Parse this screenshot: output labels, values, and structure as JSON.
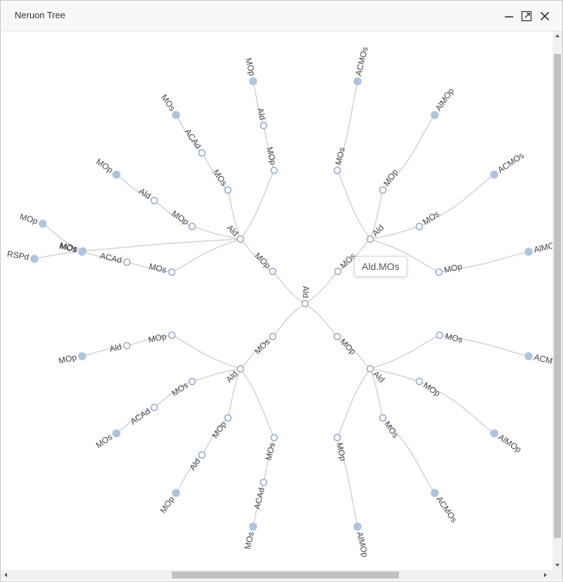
{
  "window": {
    "title": "Neruon Tree"
  },
  "tooltip": {
    "text": "Ald.MOs"
  },
  "colors": {
    "edge": "#cccccc",
    "node_stroke": "#8fa8d0",
    "leaf_fill": "#b0c4de",
    "inner_fill": "#ffffff"
  },
  "icons": {
    "minimize": "minimize-icon",
    "maximize": "maximize-icon",
    "close": "close-icon"
  },
  "tree": {
    "label": "Ald",
    "children": [
      {
        "label": "MOs",
        "children": [
          {
            "label": "Ald",
            "children": [
              {
                "label": "MOs",
                "children": [
                  {
                    "label": "ACMOs",
                    "leaf": true
                  }
                ]
              },
              {
                "label": "MOp",
                "children": [
                  {
                    "label": "AlMOp",
                    "leaf": true
                  }
                ]
              },
              {
                "label": "MOs",
                "children": [
                  {
                    "label": "ACMOs",
                    "leaf": true
                  }
                ]
              },
              {
                "label": "MOp",
                "children": [
                  {
                    "label": "AlMOp",
                    "leaf": true
                  }
                ]
              }
            ]
          }
        ]
      },
      {
        "label": "MOp",
        "children": [
          {
            "label": "Ald",
            "children": [
              {
                "label": "MOs",
                "children": [
                  {
                    "label": "ACMOs",
                    "leaf": true
                  }
                ]
              },
              {
                "label": "MOp",
                "children": [
                  {
                    "label": "AlMOp",
                    "leaf": true
                  }
                ]
              },
              {
                "label": "MOs",
                "children": [
                  {
                    "label": "ACMOs",
                    "leaf": true
                  }
                ]
              },
              {
                "label": "MOp",
                "children": [
                  {
                    "label": "AlMOp",
                    "leaf": true
                  }
                ]
              }
            ]
          }
        ]
      },
      {
        "label": "MOs",
        "children": [
          {
            "label": "Ald",
            "children": [
              {
                "label": "MOs",
                "children": [
                  {
                    "label": "ACAd",
                    "leaf": false,
                    "children": [
                      {
                        "label": "MOs",
                        "leaf": true
                      }
                    ]
                  }
                ]
              },
              {
                "label": "MOp",
                "children": [
                  {
                    "label": "Ald",
                    "children": [
                      {
                        "label": "MOp",
                        "leaf": true
                      }
                    ]
                  }
                ]
              },
              {
                "label": "MOs",
                "children": [
                  {
                    "label": "ACAd",
                    "children": [
                      {
                        "label": "MOs",
                        "leaf": true
                      }
                    ]
                  }
                ]
              },
              {
                "label": "MOp",
                "children": [
                  {
                    "label": "Ald",
                    "children": [
                      {
                        "label": "MOp",
                        "leaf": true
                      }
                    ]
                  }
                ]
              }
            ]
          }
        ]
      },
      {
        "label": "MOp",
        "children": [
          {
            "label": "Ald",
            "children": [
              {
                "label": "MOs",
                "children": [
                  {
                    "label": "ACAd",
                    "children": [
                      {
                        "label": "MOs",
                        "leaf": true
                      }
                    ]
                  }
                ]
              },
              {
                "label": "MOs",
                "children": [
                  {
                    "label": "MOp",
                    "leaf": true
                  },
                  {
                    "label": "RSPd",
                    "leaf": true
                  }
                ]
              },
              {
                "label": "MOp",
                "children": [
                  {
                    "label": "Ald",
                    "children": [
                      {
                        "label": "MOp",
                        "leaf": true
                      }
                    ]
                  }
                ]
              },
              {
                "label": "MOs",
                "children": [
                  {
                    "label": "ACAd",
                    "children": [
                      {
                        "label": "MOs",
                        "leaf": true
                      }
                    ]
                  }
                ]
              },
              {
                "label": "MOp",
                "children": [
                  {
                    "label": "Ald",
                    "children": [
                      {
                        "label": "MOp",
                        "leaf": true
                      }
                    ]
                  }
                ]
              }
            ]
          }
        ]
      }
    ]
  }
}
